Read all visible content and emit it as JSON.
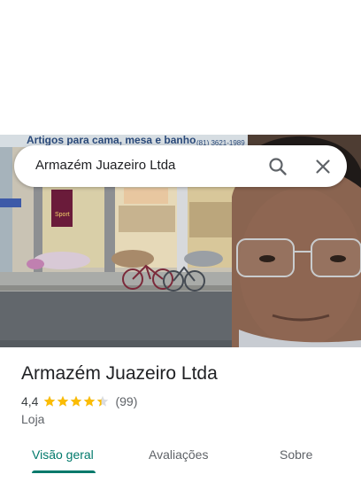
{
  "search": {
    "query": "Armazém Juazeiro Ltda"
  },
  "photo": {
    "store_sign": "Artigos para cama, mesa e banho",
    "phone": "(81) 3621-1989",
    "shirt_text": "Sport"
  },
  "place": {
    "name": "Armazém Juazeiro Ltda",
    "rating": "4,4",
    "rating_value": 4.4,
    "review_count": "(99)",
    "category": "Loja"
  },
  "tabs": [
    {
      "label": "Visão geral",
      "active": true
    },
    {
      "label": "Avaliações",
      "active": false
    },
    {
      "label": "Sobre",
      "active": false
    }
  ],
  "colors": {
    "accent": "#00796b",
    "star": "#fbbc04",
    "text": "#202124"
  }
}
